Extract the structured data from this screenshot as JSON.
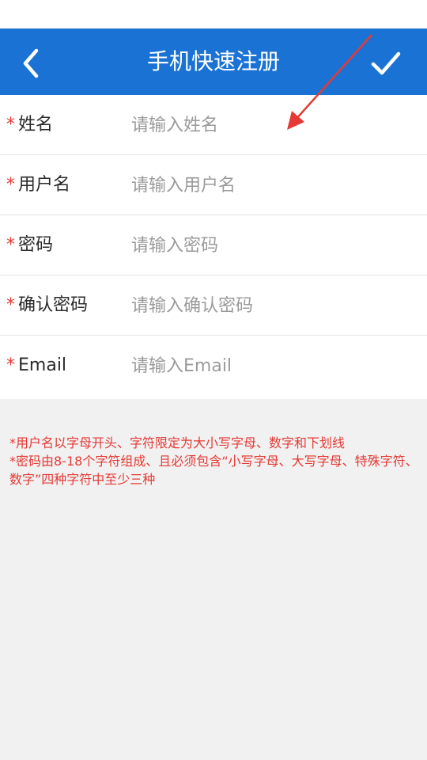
{
  "header": {
    "title": "手机快速注册",
    "back_icon": "chevron-left-icon",
    "confirm_icon": "checkmark-icon"
  },
  "form": {
    "required_mark": "*",
    "fields": [
      {
        "label": "姓名",
        "placeholder": "请输入姓名",
        "value": ""
      },
      {
        "label": "用户名",
        "placeholder": "请输入用户名",
        "value": ""
      },
      {
        "label": "密码",
        "placeholder": "请输入密码",
        "value": ""
      },
      {
        "label": "确认密码",
        "placeholder": "请输入确认密码",
        "value": ""
      },
      {
        "label": "Email",
        "placeholder": "请输入Email",
        "value": ""
      }
    ]
  },
  "notes": {
    "line1": "*用户名以字母开头、字符限定为大小写字母、数字和下划线",
    "line2": "*密码由8-18个字符组成、且必须包含“小写字母、大写字母、特殊字符、数字”四种字符中至少三种"
  },
  "colors": {
    "appbar": "#1a73d4",
    "required": "#e53935",
    "background": "#f1f1f1",
    "annotation_arrow": "#e53935"
  }
}
